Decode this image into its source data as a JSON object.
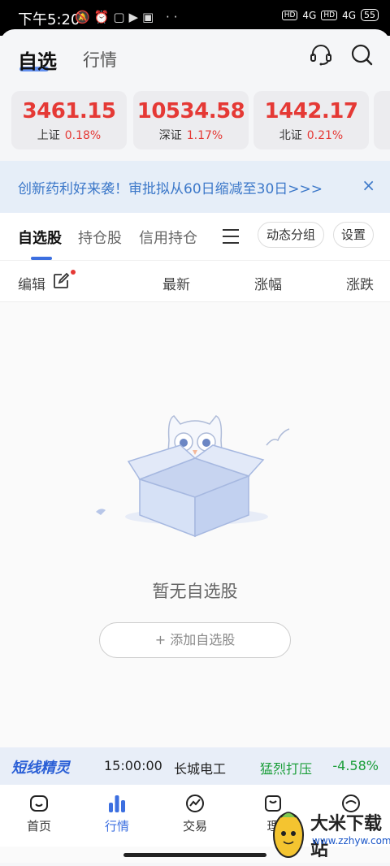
{
  "status_bar": {
    "time": "下午5:20",
    "network1": "4G",
    "network2": "4G",
    "hd": "HD",
    "battery": "55"
  },
  "header": {
    "tabs": [
      "自选",
      "行情"
    ],
    "active_tab": "自选"
  },
  "indices": [
    {
      "value": "3461.15",
      "name": "上证",
      "change": "0.18%"
    },
    {
      "value": "10534.58",
      "name": "深证",
      "change": "1.17%"
    },
    {
      "value": "1442.17",
      "name": "北证",
      "change": "0.21%"
    }
  ],
  "banner": {
    "text": "创新药利好来袭！审批拟从60日缩减至30日>>>",
    "close": "×"
  },
  "sub_tabs": {
    "items": [
      "自选股",
      "持仓股",
      "信用持仓"
    ],
    "group_button": "动态分组",
    "settings_button": "设置"
  },
  "columns": {
    "edit": "编辑",
    "latest": "最新",
    "change_pct": "涨幅",
    "change": "涨跌"
  },
  "empty": {
    "message": "暂无自选股",
    "add_button": "+ 添加自选股"
  },
  "ticker": {
    "brand": "短线精灵",
    "time": "15:00:00",
    "stock": "长城电工",
    "event": "猛烈打压",
    "change": "-4.58%"
  },
  "bottom_nav": {
    "items": [
      {
        "label": "首页",
        "icon": "home-icon"
      },
      {
        "label": "行情",
        "icon": "chart-bars-icon"
      },
      {
        "label": "交易",
        "icon": "trade-icon"
      },
      {
        "label": "理",
        "icon": "wealth-icon"
      },
      {
        "label": "",
        "icon": "profile-icon"
      }
    ],
    "active": "行情"
  },
  "watermark": {
    "title": "大米下载站",
    "url": "www.zzhyw.com"
  },
  "colors": {
    "up": "#e53935",
    "down": "#1b9e3a",
    "accent": "#3c6fe0"
  }
}
